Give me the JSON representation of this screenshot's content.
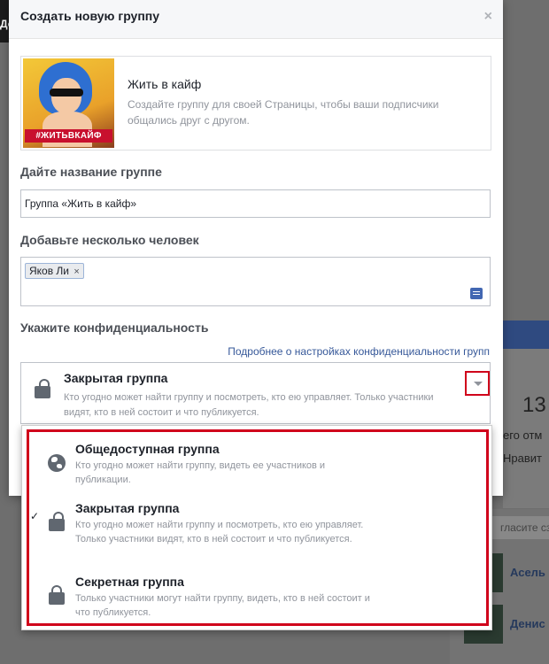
{
  "background": {
    "top_left_text": "До",
    "number": "13",
    "text_1": "его отм",
    "text_2": "Нравит",
    "search_placeholder": "гласите сз",
    "friends": [
      {
        "name": "Асель"
      },
      {
        "name": "Денис"
      }
    ]
  },
  "dialog": {
    "title": "Создать новую группу",
    "close_label": "×",
    "template": {
      "image_tag": "#ЖИТЬВКАЙФ",
      "name": "Жить в кайф",
      "description": "Создайте группу для своей Страницы, чтобы ваши подписчики общались друг с другом."
    },
    "group_name": {
      "label": "Дайте название группе",
      "value": "Группа «Жить в кайф»"
    },
    "members": {
      "label": "Добавьте несколько человек",
      "chips": [
        {
          "name": "Яков Ли",
          "remove": "×"
        }
      ]
    },
    "privacy": {
      "label": "Укажите конфиденциальность",
      "learn_more_link": "Подробнее о настройках конфиденциальности групп",
      "selected": {
        "title": "Закрытая группа",
        "description": "Кто угодно может найти группу и посмотреть, кто ею управляет. Только участники видят, кто в ней состоит и что публикуется."
      },
      "options": [
        {
          "title": "Общедоступная группа",
          "description": "Кто угодно может найти группу, видеть ее участников и публикации.",
          "icon": "globe-icon",
          "checked": false
        },
        {
          "title": "Закрытая группа",
          "description": "Кто угодно может найти группу и посмотреть, кто ею управляет. Только участники видят, кто в ней состоит и что публикуется.",
          "icon": "lock-open-icon",
          "checked": true,
          "check_mark": "✓"
        },
        {
          "title": "Секретная группа",
          "description": "Только участники могут найти группу, видеть, кто в ней состоит и что публикуется.",
          "icon": "lock-icon",
          "checked": false
        }
      ]
    }
  },
  "colors": {
    "highlight": "#d0021b",
    "link": "#365899",
    "brand": "#4267b2"
  }
}
